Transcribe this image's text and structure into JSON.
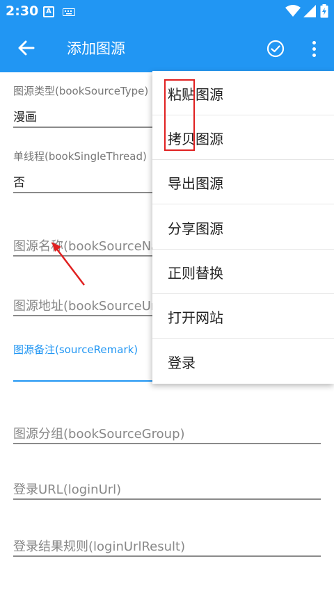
{
  "status": {
    "time": "2:30",
    "app_icon": "A"
  },
  "appbar": {
    "title": "添加图源"
  },
  "fields": [
    {
      "label": "图源类型(bookSourceType)",
      "value": "漫画"
    },
    {
      "label": "单线程(bookSingleThread)",
      "value": "否"
    },
    {
      "hint": "图源名称(bookSourceNa"
    },
    {
      "hint": "图源地址(bookSourceUrl"
    },
    {
      "label": "图源备注(sourceRemark)",
      "value": ""
    },
    {
      "hint": "图源分组(bookSourceGroup)"
    },
    {
      "hint": "登录URL(loginUrl)"
    },
    {
      "hint": "登录结果规则(loginUrlResult)"
    }
  ],
  "menu": {
    "items": [
      "粘贴图源",
      "拷贝图源",
      "导出图源",
      "分享图源",
      "正则替换",
      "打开网站",
      "登录"
    ]
  },
  "colors": {
    "primary": "#2196F3",
    "annotation": "#e02020"
  }
}
